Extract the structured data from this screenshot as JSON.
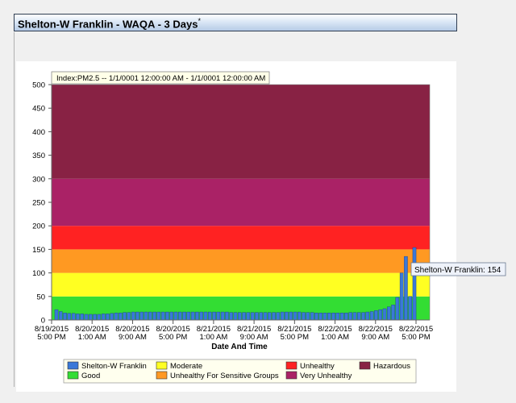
{
  "page": {
    "title": "Shelton-W Franklin - WAQA - 3 Days",
    "title_marker": "*"
  },
  "chart_data": {
    "type": "bar",
    "index_label": "Index:PM2.5 -- 1/1/0001 12:00:00 AM  -  1/1/0001 12:00:00 AM",
    "xlabel": "Date And Time",
    "ylabel": "",
    "ylim": [
      0,
      500
    ],
    "yticks": [
      0,
      50,
      100,
      150,
      200,
      250,
      300,
      350,
      400,
      450,
      500
    ],
    "x_tick_labels": [
      [
        "8/19/2015",
        "5:00 PM"
      ],
      [
        "8/20/2015",
        "1:00 AM"
      ],
      [
        "8/20/2015",
        "9:00 AM"
      ],
      [
        "8/20/2015",
        "5:00 PM"
      ],
      [
        "8/21/2015",
        "1:00 AM"
      ],
      [
        "8/21/2015",
        "9:00 AM"
      ],
      [
        "8/21/2015",
        "5:00 PM"
      ],
      [
        "8/22/2015",
        "1:00 AM"
      ],
      [
        "8/22/2015",
        "9:00 AM"
      ],
      [
        "8/22/2015",
        "5:00 PM"
      ]
    ],
    "bands": [
      {
        "name": "Good",
        "from": 0,
        "to": 50,
        "color": "#33dd33"
      },
      {
        "name": "Moderate",
        "from": 50,
        "to": 100,
        "color": "#ffff22"
      },
      {
        "name": "Unhealthy For Sensitive Groups",
        "from": 100,
        "to": 150,
        "color": "#ff9922"
      },
      {
        "name": "Unhealthy",
        "from": 150,
        "to": 200,
        "color": "#ff2222"
      },
      {
        "name": "Very Unhealthy",
        "from": 200,
        "to": 300,
        "color": "#aa2266"
      },
      {
        "name": "Hazardous",
        "from": 300,
        "to": 500,
        "color": "#882244"
      }
    ],
    "series": [
      {
        "name": "Shelton-W Franklin",
        "color": "#3a78d8",
        "values": [
          22,
          18,
          15,
          14,
          14,
          13,
          13,
          12,
          12,
          12,
          12,
          13,
          13,
          14,
          15,
          15,
          16,
          16,
          17,
          17,
          17,
          17,
          17,
          17,
          17,
          17,
          17,
          17,
          17,
          17,
          17,
          17,
          17,
          17,
          17,
          17,
          17,
          17,
          17,
          17,
          17,
          16,
          16,
          16,
          16,
          16,
          16,
          16,
          16,
          16,
          16,
          16,
          16,
          17,
          17,
          17,
          17,
          17,
          16,
          16,
          16,
          15,
          15,
          15,
          15,
          15,
          15,
          15,
          15,
          16,
          16,
          16,
          16,
          17,
          18,
          20,
          22,
          24,
          28,
          32,
          48,
          100,
          135,
          50,
          154
        ]
      }
    ],
    "tooltip": "Shelton-W Franklin: 154",
    "legend": {
      "placement": "bottom",
      "items": [
        {
          "label": "Shelton-W Franklin",
          "color": "#3a78d8"
        },
        {
          "label": "Moderate",
          "color": "#ffff22"
        },
        {
          "label": "Unhealthy",
          "color": "#ff2222"
        },
        {
          "label": "Hazardous",
          "color": "#882244"
        },
        {
          "label": "Good",
          "color": "#33dd33"
        },
        {
          "label": "Unhealthy For Sensitive Groups",
          "color": "#ff9922"
        },
        {
          "label": "Very Unhealthy",
          "color": "#aa2266"
        }
      ]
    },
    "grid": false
  }
}
